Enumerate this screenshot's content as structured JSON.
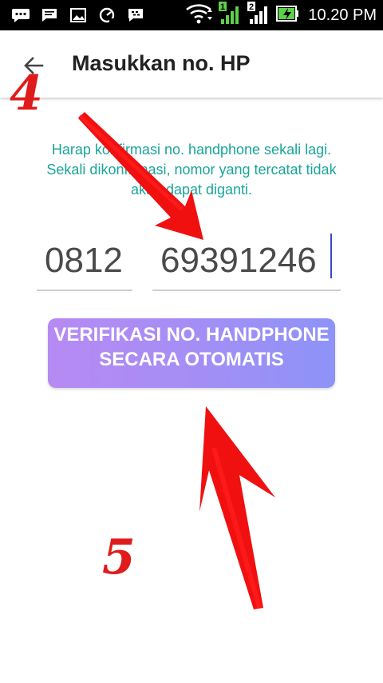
{
  "status_bar": {
    "time": "10.20 PM",
    "left_icons": [
      "chat-bubble-icon",
      "message-icon",
      "image-icon",
      "speedometer-icon",
      "bbm-icon"
    ],
    "right_icons": [
      "wifi-icon",
      "signal-1-icon",
      "signal-2-icon",
      "battery-charging-icon"
    ],
    "sim1_label": "1",
    "sim2_label": "2"
  },
  "appbar": {
    "title": "Masukkan no. HP",
    "back_icon": "arrow-left-icon"
  },
  "info_text": "Harap konfirmasi no. handphone sekali lagi. Sekali dikonfirmasi, nomor yang tercatat tidak akan dapat diganti.",
  "phone": {
    "prefix": "0812",
    "number": "69391246"
  },
  "verify_button": {
    "label": "VERIFIKASI NO. HANDPHONE SECARA OTOMATIS"
  },
  "annotations": {
    "step_4": "4",
    "step_5": "5",
    "color": "#e01b1b"
  },
  "colors": {
    "info_text": "#1aa59a",
    "button_gradient_start": "#b78af3",
    "button_gradient_end": "#8e93f7",
    "caret": "#3b46c6"
  }
}
